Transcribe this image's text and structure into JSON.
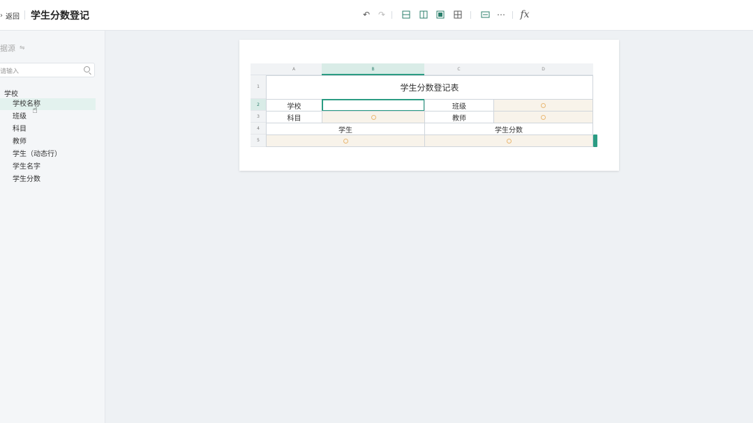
{
  "header": {
    "back_label": "返回",
    "title": "学生分数登记"
  },
  "sidebar": {
    "source_title": "据源",
    "search_placeholder": "请输入",
    "tree_root": "学校",
    "items": [
      {
        "label": "学校名称",
        "active": true
      },
      {
        "label": "班级"
      },
      {
        "label": "科目"
      },
      {
        "label": "教师"
      },
      {
        "label": "学生（动态行）"
      },
      {
        "label": "学生名字"
      },
      {
        "label": "学生分数"
      }
    ]
  },
  "sheet": {
    "columns": [
      "A",
      "B",
      "C",
      "D"
    ],
    "rows": [
      "1",
      "2",
      "3",
      "4",
      "5"
    ],
    "title": "学生分数登记表",
    "labels": {
      "school": "学校",
      "class": "班级",
      "subject": "科目",
      "teacher": "教师",
      "student": "学生",
      "score": "学生分数"
    }
  },
  "colors": {
    "accent": "#2b9c83",
    "field_bg": "#f8f3ea"
  }
}
